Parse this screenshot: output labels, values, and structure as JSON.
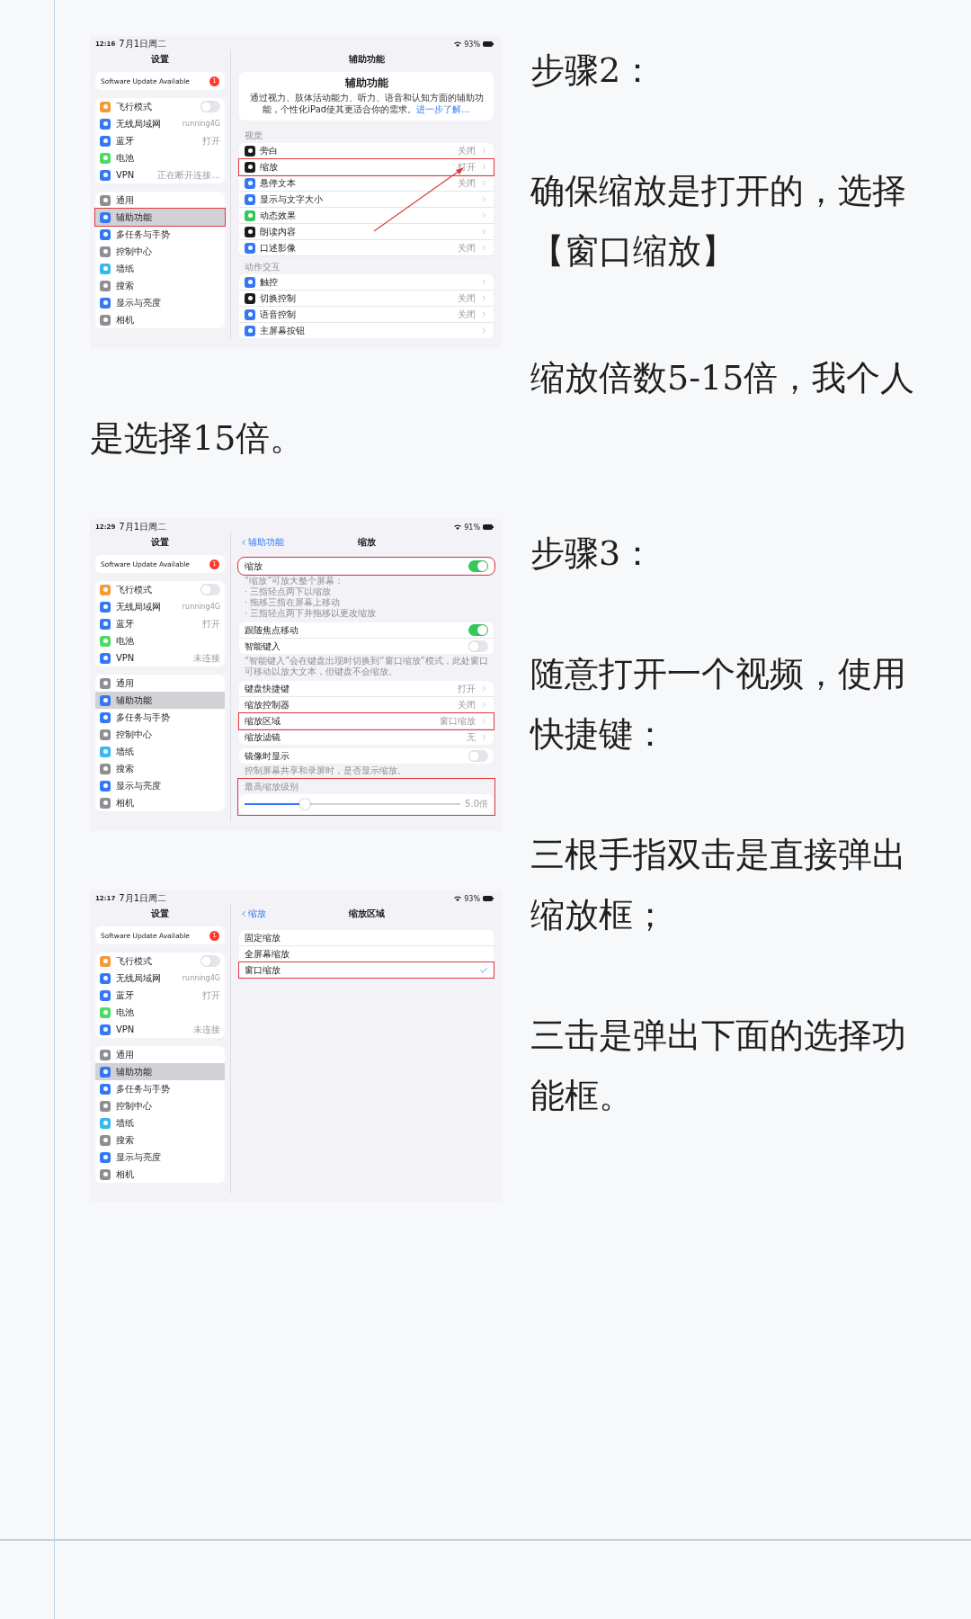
{
  "sections": [
    {
      "screenshots": [
        {
          "kind": "screenshot",
          "status": {
            "time": "12:16",
            "date": "7月1日周二",
            "battery": "93%"
          },
          "sidebar": {
            "title": "设置",
            "update": {
              "label": "Software Update Available",
              "badge": "1"
            },
            "groups": [
              {
                "items": [
                  {
                    "kind": "switch",
                    "label": "飞行模式",
                    "on": false,
                    "color": "#f29b38",
                    "selected": false,
                    "annotated": false
                  },
                  {
                    "kind": "link",
                    "label": "无线局域网",
                    "value": "running4G",
                    "color": "#3478f6",
                    "selected": false,
                    "annotated": false
                  },
                  {
                    "kind": "link",
                    "label": "蓝牙",
                    "value": "打开",
                    "color": "#3478f6",
                    "selected": false,
                    "annotated": false
                  },
                  {
                    "kind": "link",
                    "label": "电池",
                    "color": "#4cd964",
                    "selected": false,
                    "annotated": false
                  },
                  {
                    "kind": "link",
                    "label": "VPN",
                    "value": "正在断开连接...",
                    "color": "#3478f6",
                    "selected": false,
                    "annotated": false
                  }
                ]
              },
              {
                "items": [
                  {
                    "kind": "link",
                    "label": "通用",
                    "color": "#8e8e93",
                    "selected": false,
                    "annotated": false
                  },
                  {
                    "kind": "link",
                    "label": "辅助功能",
                    "color": "#3478f6",
                    "selected": true,
                    "annotated": true
                  },
                  {
                    "kind": "link",
                    "label": "多任务与手势",
                    "color": "#3478f6",
                    "selected": false,
                    "annotated": false
                  },
                  {
                    "kind": "link",
                    "label": "控制中心",
                    "color": "#8e8e93",
                    "selected": false,
                    "annotated": false
                  },
                  {
                    "kind": "link",
                    "label": "墙纸",
                    "color": "#38b8f0",
                    "selected": false,
                    "annotated": false
                  },
                  {
                    "kind": "link",
                    "label": "搜索",
                    "color": "#8e8e93",
                    "selected": false,
                    "annotated": false
                  },
                  {
                    "kind": "link",
                    "label": "显示与亮度",
                    "color": "#3478f6",
                    "selected": false,
                    "annotated": false
                  },
                  {
                    "kind": "link",
                    "label": "相机",
                    "color": "#8e8e93",
                    "selected": false,
                    "annotated": false
                  }
                ]
              }
            ]
          },
          "detail": {
            "nav": {
              "title": "辅助功能"
            },
            "header": {
              "title": "辅助功能",
              "description": "通过视力、肢体活动能力、听力、语音和认知方面的辅助功能，个性化iPad使其更适合你的需求。",
              "link": "进一步了解..."
            },
            "arrow": true,
            "sections": [
              {
                "label": "视觉",
                "annotated": false,
                "rows": [
                  {
                    "kind": "link",
                    "label": "旁白",
                    "value": "关闭",
                    "color": "#1c1c1e",
                    "annotated": false
                  },
                  {
                    "kind": "link",
                    "label": "缩放",
                    "value": "打开",
                    "color": "#1c1c1e",
                    "annotated": true
                  },
                  {
                    "kind": "link",
                    "label": "悬停文本",
                    "value": "关闭",
                    "color": "#3478f6",
                    "annotated": false
                  },
                  {
                    "kind": "link",
                    "label": "显示与文字大小",
                    "color": "#3478f6",
                    "annotated": false
                  },
                  {
                    "kind": "link",
                    "label": "动态效果",
                    "color": "#34c759",
                    "annotated": false
                  },
                  {
                    "kind": "link",
                    "label": "朗读内容",
                    "color": "#1c1c1e",
                    "annotated": false
                  },
                  {
                    "kind": "link",
                    "label": "口述影像",
                    "value": "关闭",
                    "color": "#3478f6",
                    "annotated": false
                  }
                ]
              },
              {
                "label": "动作交互",
                "annotated": false,
                "rows": [
                  {
                    "kind": "link",
                    "label": "触控",
                    "color": "#3478f6",
                    "annotated": false
                  },
                  {
                    "kind": "link",
                    "label": "切换控制",
                    "value": "关闭",
                    "color": "#1c1c1e",
                    "annotated": false
                  },
                  {
                    "kind": "link",
                    "label": "语音控制",
                    "value": "关闭",
                    "color": "#3478f6",
                    "annotated": false
                  },
                  {
                    "kind": "link",
                    "label": "主屏幕按钮",
                    "color": "#3478f6",
                    "annotated": false
                  }
                ]
              }
            ]
          }
        }
      ],
      "paragraphs": [
        "步骤2：",
        "确保缩放是打开的，选择【窗口缩放】"
      ],
      "wrap_text": "缩放倍数5-15倍，我个人是选择15倍。"
    },
    {
      "screenshots": [
        {
          "kind": "screenshot",
          "status": {
            "time": "12:29",
            "date": "7月1日周二",
            "battery": "91%"
          },
          "sidebar": {
            "title": "设置",
            "update": {
              "label": "Software Update Available",
              "badge": "1"
            },
            "groups": [
              {
                "items": [
                  {
                    "kind": "switch",
                    "label": "飞行模式",
                    "on": false,
                    "color": "#f29b38",
                    "selected": false,
                    "annotated": false
                  },
                  {
                    "kind": "link",
                    "label": "无线局域网",
                    "value": "running4G",
                    "color": "#3478f6",
                    "selected": false,
                    "annotated": false
                  },
                  {
                    "kind": "link",
                    "label": "蓝牙",
                    "value": "打开",
                    "color": "#3478f6",
                    "selected": false,
                    "annotated": false
                  },
                  {
                    "kind": "link",
                    "label": "电池",
                    "color": "#4cd964",
                    "selected": false,
                    "annotated": false
                  },
                  {
                    "kind": "link",
                    "label": "VPN",
                    "value": "未连接",
                    "color": "#3478f6",
                    "selected": false,
                    "annotated": false
                  }
                ]
              },
              {
                "items": [
                  {
                    "kind": "link",
                    "label": "通用",
                    "color": "#8e8e93",
                    "selected": false,
                    "annotated": false
                  },
                  {
                    "kind": "link",
                    "label": "辅助功能",
                    "color": "#3478f6",
                    "selected": true,
                    "annotated": false
                  },
                  {
                    "kind": "link",
                    "label": "多任务与手势",
                    "color": "#3478f6",
                    "selected": false,
                    "annotated": false
                  },
                  {
                    "kind": "link",
                    "label": "控制中心",
                    "color": "#8e8e93",
                    "selected": false,
                    "annotated": false
                  },
                  {
                    "kind": "link",
                    "label": "墙纸",
                    "color": "#38b8f0",
                    "selected": false,
                    "annotated": false
                  },
                  {
                    "kind": "link",
                    "label": "搜索",
                    "color": "#8e8e93",
                    "selected": false,
                    "annotated": false
                  },
                  {
                    "kind": "link",
                    "label": "显示与亮度",
                    "color": "#3478f6",
                    "selected": false,
                    "annotated": false
                  },
                  {
                    "kind": "link",
                    "label": "相机",
                    "color": "#8e8e93",
                    "selected": false,
                    "annotated": false
                  }
                ]
              }
            ]
          },
          "detail": {
            "nav": {
              "back": "辅助功能",
              "title": "缩放"
            },
            "arrow": false,
            "sections": [
              {
                "annotated": true,
                "rows": [
                  {
                    "kind": "switch",
                    "label": "缩放",
                    "on": true,
                    "annotated": false
                  }
                ],
                "footer": [
                  "“缩放”可放大整个屏幕：",
                  "· 三指轻点两下以缩放",
                  "· 拖移三指在屏幕上移动",
                  "· 三指轻点两下并拖移以更改缩放"
                ]
              },
              {
                "annotated": false,
                "rows": [
                  {
                    "kind": "switch",
                    "label": "跟随焦点移动",
                    "on": true,
                    "annotated": false
                  },
                  {
                    "kind": "switch",
                    "label": "智能键入",
                    "on": false,
                    "annotated": false
                  }
                ],
                "footer": [
                  "“智能键入”会在键盘出现时切换到“窗口缩放”模式，此处窗口可移动以放大文本，但键盘不会缩放。"
                ]
              },
              {
                "annotated": false,
                "rows": [
                  {
                    "kind": "link",
                    "label": "键盘快捷键",
                    "value": "打开",
                    "annotated": false
                  },
                  {
                    "kind": "link",
                    "label": "缩放控制器",
                    "value": "关闭",
                    "annotated": false
                  },
                  {
                    "kind": "link",
                    "label": "缩放区域",
                    "value": "窗口缩放",
                    "annotated": true
                  },
                  {
                    "kind": "link",
                    "label": "缩放滤镜",
                    "value": "无",
                    "annotated": false
                  }
                ]
              },
              {
                "annotated": false,
                "rows": [
                  {
                    "kind": "switch",
                    "label": "镜像时显示",
                    "on": false,
                    "annotated": false
                  }
                ],
                "footer": [
                  "控制屏幕共享和录屏时，是否显示缩放。"
                ]
              },
              {
                "label": "最高缩放级别",
                "annotated": true,
                "rows": [
                  {
                    "kind": "slider",
                    "level": 0.28,
                    "reading": "5.0倍",
                    "annotated": false
                  }
                ]
              }
            ]
          }
        },
        {
          "kind": "screenshot",
          "status": {
            "time": "12:17",
            "date": "7月1日周二",
            "battery": "93%"
          },
          "sidebar": {
            "title": "设置",
            "update": {
              "label": "Software Update Available",
              "badge": "1"
            },
            "groups": [
              {
                "items": [
                  {
                    "kind": "switch",
                    "label": "飞行模式",
                    "on": false,
                    "color": "#f29b38",
                    "selected": false,
                    "annotated": false
                  },
                  {
                    "kind": "link",
                    "label": "无线局域网",
                    "value": "running4G",
                    "color": "#3478f6",
                    "selected": false,
                    "annotated": false
                  },
                  {
                    "kind": "link",
                    "label": "蓝牙",
                    "value": "打开",
                    "color": "#3478f6",
                    "selected": false,
                    "annotated": false
                  },
                  {
                    "kind": "link",
                    "label": "电池",
                    "color": "#4cd964",
                    "selected": false,
                    "annotated": false
                  },
                  {
                    "kind": "link",
                    "label": "VPN",
                    "value": "未连接",
                    "color": "#3478f6",
                    "selected": false,
                    "annotated": false
                  }
                ]
              },
              {
                "items": [
                  {
                    "kind": "link",
                    "label": "通用",
                    "color": "#8e8e93",
                    "selected": false,
                    "annotated": false
                  },
                  {
                    "kind": "link",
                    "label": "辅助功能",
                    "color": "#3478f6",
                    "selected": true,
                    "annotated": false
                  },
                  {
                    "kind": "link",
                    "label": "多任务与手势",
                    "color": "#3478f6",
                    "selected": false,
                    "annotated": false
                  },
                  {
                    "kind": "link",
                    "label": "控制中心",
                    "color": "#8e8e93",
                    "selected": false,
                    "annotated": false
                  },
                  {
                    "kind": "link",
                    "label": "墙纸",
                    "color": "#38b8f0",
                    "selected": false,
                    "annotated": false
                  },
                  {
                    "kind": "link",
                    "label": "搜索",
                    "color": "#8e8e93",
                    "selected": false,
                    "annotated": false
                  },
                  {
                    "kind": "link",
                    "label": "显示与亮度",
                    "color": "#3478f6",
                    "selected": false,
                    "annotated": false
                  },
                  {
                    "kind": "link",
                    "label": "相机",
                    "color": "#8e8e93",
                    "selected": false,
                    "annotated": false
                  }
                ]
              }
            ]
          },
          "detail": {
            "nav": {
              "back": "缩放",
              "title": "缩放区域"
            },
            "arrow": false,
            "sections": [
              {
                "annotated": false,
                "rows": [
                  {
                    "kind": "choice",
                    "label": "固定缩放",
                    "selected": false,
                    "annotated": false
                  },
                  {
                    "kind": "choice",
                    "label": "全屏幕缩放",
                    "selected": false,
                    "annotated": false
                  },
                  {
                    "kind": "choice",
                    "label": "窗口缩放",
                    "selected": true,
                    "annotated": true
                  }
                ]
              }
            ]
          }
        }
      ],
      "paragraphs": [
        "步骤3：",
        "随意打开一个视频，使用快捷键：",
        "三根手指双击是直接弹出缩放框；",
        "三击是弹出下面的选择功能框。"
      ]
    }
  ]
}
